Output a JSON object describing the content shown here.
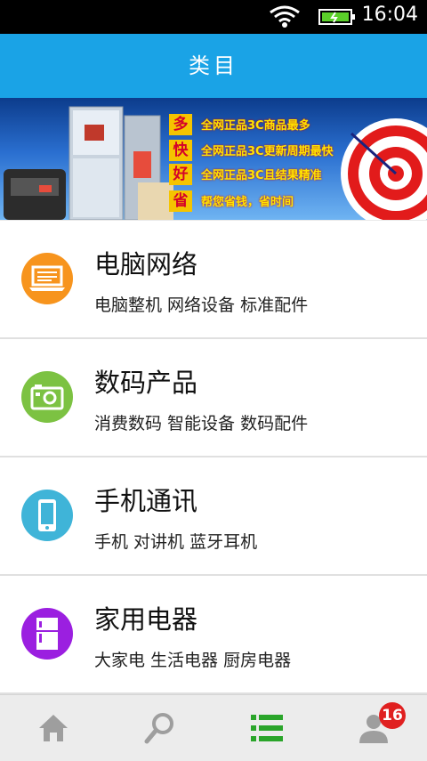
{
  "status_bar": {
    "time": "16:04"
  },
  "header": {
    "title": "类目"
  },
  "banner": {
    "rows": [
      {
        "key": "多",
        "text": "全网正品3C商品最多"
      },
      {
        "key": "快",
        "text": "全网正品3C更新周期最快"
      },
      {
        "key": "好",
        "text": "全网正品3C且结果精准"
      },
      {
        "key": "省",
        "text": "帮您省钱，省时间"
      }
    ]
  },
  "categories": [
    {
      "title": "电脑网络",
      "subtitle": "电脑整机 网络设备 标准配件",
      "icon": "laptop-icon",
      "color": "#f7941d"
    },
    {
      "title": "数码产品",
      "subtitle": "消费数码 智能设备 数码配件",
      "icon": "camera-icon",
      "color": "#7cc242"
    },
    {
      "title": "手机通讯",
      "subtitle": "手机 对讲机 蓝牙耳机",
      "icon": "phone-icon",
      "color": "#3fb4d8"
    },
    {
      "title": "家用电器",
      "subtitle": "大家电 生活电器 厨房电器",
      "icon": "fridge-icon",
      "color": "#9b1fe0"
    }
  ],
  "tabbar": {
    "tabs": [
      {
        "icon": "home-icon",
        "active": false
      },
      {
        "icon": "search-icon",
        "active": false
      },
      {
        "icon": "list-icon",
        "active": true
      },
      {
        "icon": "user-icon",
        "active": false
      }
    ],
    "badge": "16",
    "active_color": "#2aa52a",
    "inactive_color": "#9e9e9e"
  }
}
